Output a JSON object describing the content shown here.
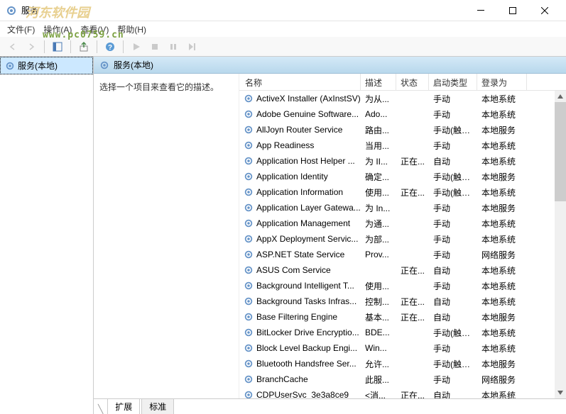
{
  "window": {
    "title": "服务",
    "watermark1": "河东软件园",
    "watermark2": "www.pc0759.cn"
  },
  "menu": {
    "file": "文件(F)",
    "action": "操作(A)",
    "view": "查看(V)",
    "help": "帮助(H)"
  },
  "tree": {
    "root": "服务(本地)"
  },
  "panel": {
    "header": "服务(本地)",
    "selectPrompt": "选择一个项目来查看它的描述。"
  },
  "columns": {
    "name": "名称",
    "desc": "描述",
    "status": "状态",
    "startup": "启动类型",
    "logon": "登录为"
  },
  "services": [
    {
      "name": "ActiveX Installer (AxInstSV)",
      "desc": "为从...",
      "status": "",
      "startup": "手动",
      "logon": "本地系统"
    },
    {
      "name": "Adobe Genuine Software...",
      "desc": "Ado...",
      "status": "",
      "startup": "手动",
      "logon": "本地系统"
    },
    {
      "name": "AllJoyn Router Service",
      "desc": "路由...",
      "status": "",
      "startup": "手动(触发...",
      "logon": "本地服务"
    },
    {
      "name": "App Readiness",
      "desc": "当用...",
      "status": "",
      "startup": "手动",
      "logon": "本地系统"
    },
    {
      "name": "Application Host Helper ...",
      "desc": "为 II...",
      "status": "正在...",
      "startup": "自动",
      "logon": "本地系统"
    },
    {
      "name": "Application Identity",
      "desc": "确定...",
      "status": "",
      "startup": "手动(触发...",
      "logon": "本地服务"
    },
    {
      "name": "Application Information",
      "desc": "使用...",
      "status": "正在...",
      "startup": "手动(触发...",
      "logon": "本地系统"
    },
    {
      "name": "Application Layer Gatewa...",
      "desc": "为 In...",
      "status": "",
      "startup": "手动",
      "logon": "本地服务"
    },
    {
      "name": "Application Management",
      "desc": "为通...",
      "status": "",
      "startup": "手动",
      "logon": "本地系统"
    },
    {
      "name": "AppX Deployment Servic...",
      "desc": "为部...",
      "status": "",
      "startup": "手动",
      "logon": "本地系统"
    },
    {
      "name": "ASP.NET State Service",
      "desc": "Prov...",
      "status": "",
      "startup": "手动",
      "logon": "网络服务"
    },
    {
      "name": "ASUS Com Service",
      "desc": "",
      "status": "正在...",
      "startup": "自动",
      "logon": "本地系统"
    },
    {
      "name": "Background Intelligent T...",
      "desc": "使用...",
      "status": "",
      "startup": "手动",
      "logon": "本地系统"
    },
    {
      "name": "Background Tasks Infras...",
      "desc": "控制...",
      "status": "正在...",
      "startup": "自动",
      "logon": "本地系统"
    },
    {
      "name": "Base Filtering Engine",
      "desc": "基本...",
      "status": "正在...",
      "startup": "自动",
      "logon": "本地服务"
    },
    {
      "name": "BitLocker Drive Encryptio...",
      "desc": "BDE...",
      "status": "",
      "startup": "手动(触发...",
      "logon": "本地系统"
    },
    {
      "name": "Block Level Backup Engi...",
      "desc": "Win...",
      "status": "",
      "startup": "手动",
      "logon": "本地系统"
    },
    {
      "name": "Bluetooth Handsfree Ser...",
      "desc": "允许...",
      "status": "",
      "startup": "手动(触发...",
      "logon": "本地服务"
    },
    {
      "name": "BranchCache",
      "desc": "此服...",
      "status": "",
      "startup": "手动",
      "logon": "网络服务"
    },
    {
      "name": "CDPUserSvc_3e3a8ce9",
      "desc": "<消...",
      "status": "正在...",
      "startup": "自动",
      "logon": "本地系统"
    }
  ],
  "tabs": {
    "extended": "扩展",
    "standard": "标准"
  }
}
